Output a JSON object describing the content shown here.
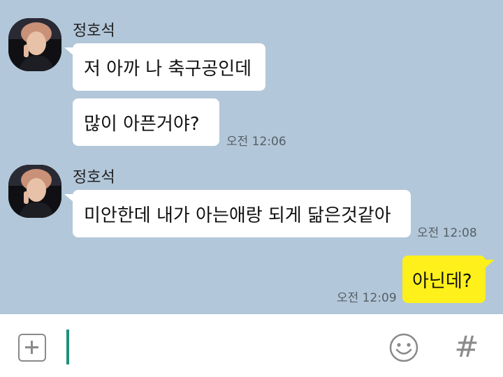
{
  "messages": [
    {
      "sender": "정호석",
      "text": "저 아까 나 축구공인데",
      "direction": "incoming"
    },
    {
      "text": "많이 아픈거야?",
      "time": "오전 12:06",
      "direction": "incoming"
    },
    {
      "sender": "정호석",
      "text": "미안한데 내가 아는애랑 되게 닮은것같아",
      "time": "오전 12:08",
      "direction": "incoming"
    },
    {
      "text": "아닌데?",
      "time": "오전 12:09",
      "direction": "outgoing"
    }
  ],
  "input": {
    "value": "",
    "placeholder": ""
  },
  "icons": {
    "attach": "plus-box-icon",
    "emoji": "smiley-icon",
    "hashtag": "hashtag-icon"
  },
  "colors": {
    "background": "#b2c7d9",
    "incoming_bubble": "#ffffff",
    "outgoing_bubble": "#fef01b",
    "cursor": "#1f8f7a"
  }
}
